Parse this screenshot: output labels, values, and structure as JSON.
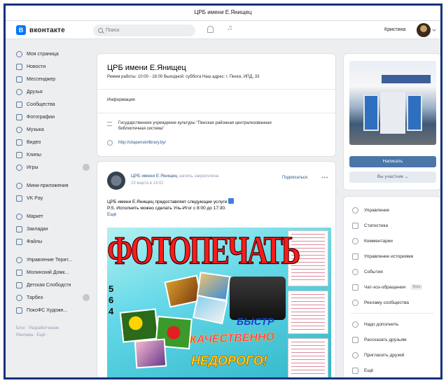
{
  "window": {
    "title": "ЦРБ имени Е.Янищец"
  },
  "topbar": {
    "logo_text": "вконтакте",
    "search_placeholder": "Поиск",
    "user_name": "Кристина"
  },
  "sidebar": {
    "items": [
      {
        "label": "Моя страница",
        "icon": "user-icon"
      },
      {
        "label": "Новости",
        "icon": "news-icon"
      },
      {
        "label": "Мессенджер",
        "icon": "chat-icon"
      },
      {
        "label": "Друзья",
        "icon": "friends-icon"
      },
      {
        "label": "Сообщества",
        "icon": "groups-icon"
      },
      {
        "label": "Фотографии",
        "icon": "photo-icon"
      },
      {
        "label": "Музыка",
        "icon": "music-icon"
      },
      {
        "label": "Видео",
        "icon": "video-icon"
      },
      {
        "label": "Клипы",
        "icon": "clips-icon"
      },
      {
        "label": "Игры",
        "icon": "games-icon"
      }
    ],
    "items2": [
      {
        "label": "Мини-приложения",
        "icon": "apps-icon"
      },
      {
        "label": "VK Pay",
        "icon": "pay-icon"
      }
    ],
    "items3": [
      {
        "label": "Маркет",
        "icon": "market-icon"
      },
      {
        "label": "Закладки",
        "icon": "bookmark-icon"
      },
      {
        "label": "Файлы",
        "icon": "files-icon"
      }
    ],
    "items4": [
      {
        "label": "Управление Терит...",
        "icon": "group-icon"
      },
      {
        "label": "Молинский Домк...",
        "icon": "group-icon"
      },
      {
        "label": "Детская Слободстн",
        "icon": "group-icon"
      },
      {
        "label": "Тарбео",
        "icon": "group-icon"
      },
      {
        "label": "ПокоФС Художн...",
        "icon": "group-icon"
      }
    ],
    "footer_line1": "Блог · Разработчикам",
    "footer_line2": "Реклама · Ещё ·"
  },
  "group": {
    "name": "ЦРБ имени Е.Янищец",
    "status": "Режим работы: 10:00 - 18:00 Выходной: суббота Наш адрес: г. Пенск, ИПД, 33",
    "info_tab": "Информация",
    "description": "Государственное учреждение культуры \"Пенская районная централизованная библиотечная система\"",
    "link": "http://citapenskrlibrary.by/"
  },
  "post": {
    "author": "ЦРБ имени Е.Янищец",
    "author_extra": "запись закреплена",
    "date": "23 марта в 14:02",
    "subscribe_label": "Подписаться",
    "text_line1": "ЦРБ имени Е.Янищец предоставляет следующие услуги",
    "text_line2": "P.S. Исполнить можно сделать Уль-Итог с 8:00 до 17:30.",
    "more_label": "Ещё",
    "image": {
      "headline": "ФОТОПЕЧАТЬ",
      "digits": [
        "5",
        "6",
        "4"
      ],
      "slogan_fast": "БЫСТР",
      "slogan_quality": "КАЧЕСТВЕННО",
      "slogan_cheap": "НЕДОРОГО!"
    }
  },
  "cover": {
    "write_label": "Написать",
    "joined_label": "Вы участник ⌄"
  },
  "admin_menu": {
    "items": [
      {
        "label": "Управление",
        "icon": "settings-icon"
      },
      {
        "label": "Статистика",
        "icon": "stats-icon"
      },
      {
        "label": "Комментарии",
        "icon": "comments-icon"
      },
      {
        "label": "Управление историями",
        "icon": "stories-icon"
      },
      {
        "label": "События",
        "icon": "events-icon"
      },
      {
        "label": "Чат-хоз-обращения",
        "icon": "bot-icon",
        "tag": "Beta"
      },
      {
        "label": "Рекламу сообщества",
        "icon": "ads-icon"
      }
    ],
    "items2": [
      {
        "label": "Надо дополнить",
        "icon": "edit-icon"
      },
      {
        "label": "Рассказать друзьям",
        "icon": "share-icon"
      },
      {
        "label": "Пригласить друзей",
        "icon": "invite-icon"
      },
      {
        "label": "Ещё",
        "icon": "more-icon"
      }
    ]
  },
  "colors": {
    "frame": "#17327a",
    "accent": "#4a76a8",
    "link": "#2a5885",
    "background": "#edeef0"
  }
}
